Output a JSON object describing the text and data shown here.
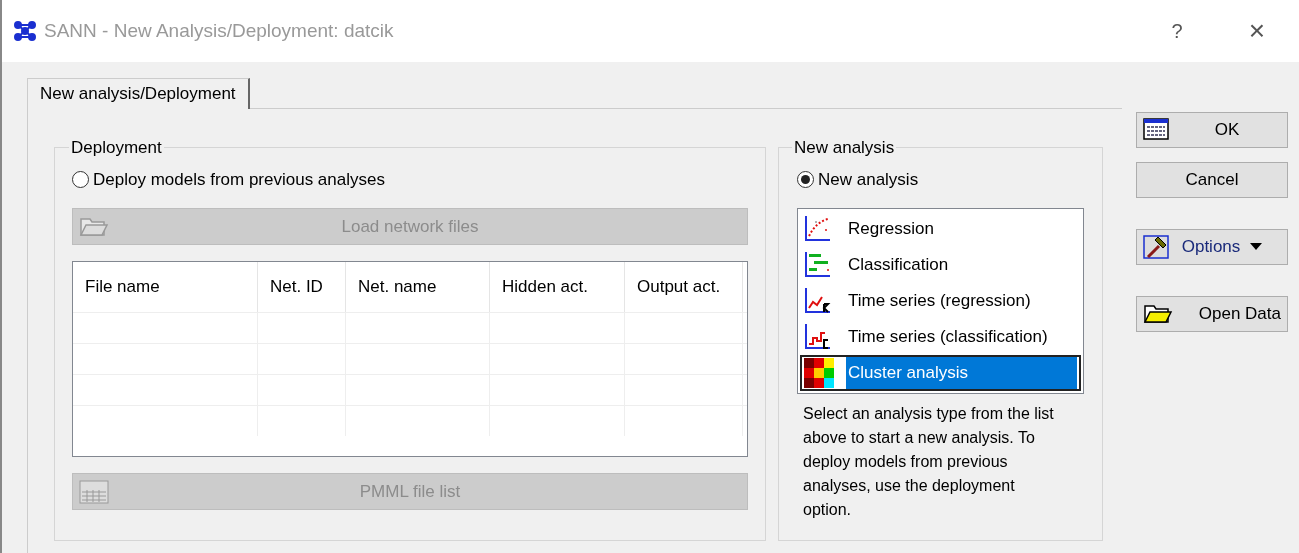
{
  "window": {
    "title": "SANN - New Analysis/Deployment: datcik",
    "help": "?",
    "close": "×"
  },
  "tabs": [
    {
      "label": "New analysis/Deployment",
      "selected": true
    }
  ],
  "deployment": {
    "title": "Deployment",
    "radio": {
      "label": "Deploy models from previous analyses",
      "selected": false
    },
    "load_button": {
      "label": "Load network files",
      "disabled": true
    },
    "table": {
      "columns": [
        "File name",
        "Net. ID",
        "Net. name",
        "Hidden act.",
        "Output act."
      ]
    },
    "pmml_button": {
      "label": "PMML file list",
      "disabled": true
    }
  },
  "new_analysis": {
    "title": "New analysis",
    "radio": {
      "label": "New analysis",
      "selected": true
    },
    "types": [
      {
        "label": "Regression",
        "kind": "regression",
        "selected": false
      },
      {
        "label": "Classification",
        "kind": "classification",
        "selected": false
      },
      {
        "label": "Time series (regression)",
        "kind": "ts-regression",
        "selected": false
      },
      {
        "label": "Time series (classification)",
        "kind": "ts-classification",
        "selected": false
      },
      {
        "label": "Cluster analysis",
        "kind": "cluster",
        "selected": true
      }
    ],
    "hint": "Select an analysis type from the list above to start a new analysis. To deploy models from previous analyses, use the deployment option."
  },
  "buttons": [
    {
      "label": "OK",
      "kind": "ok"
    },
    {
      "label": "Cancel",
      "kind": "cancel"
    },
    {
      "label": "Options",
      "kind": "options"
    },
    {
      "label": "Open Data",
      "kind": "open"
    }
  ]
}
